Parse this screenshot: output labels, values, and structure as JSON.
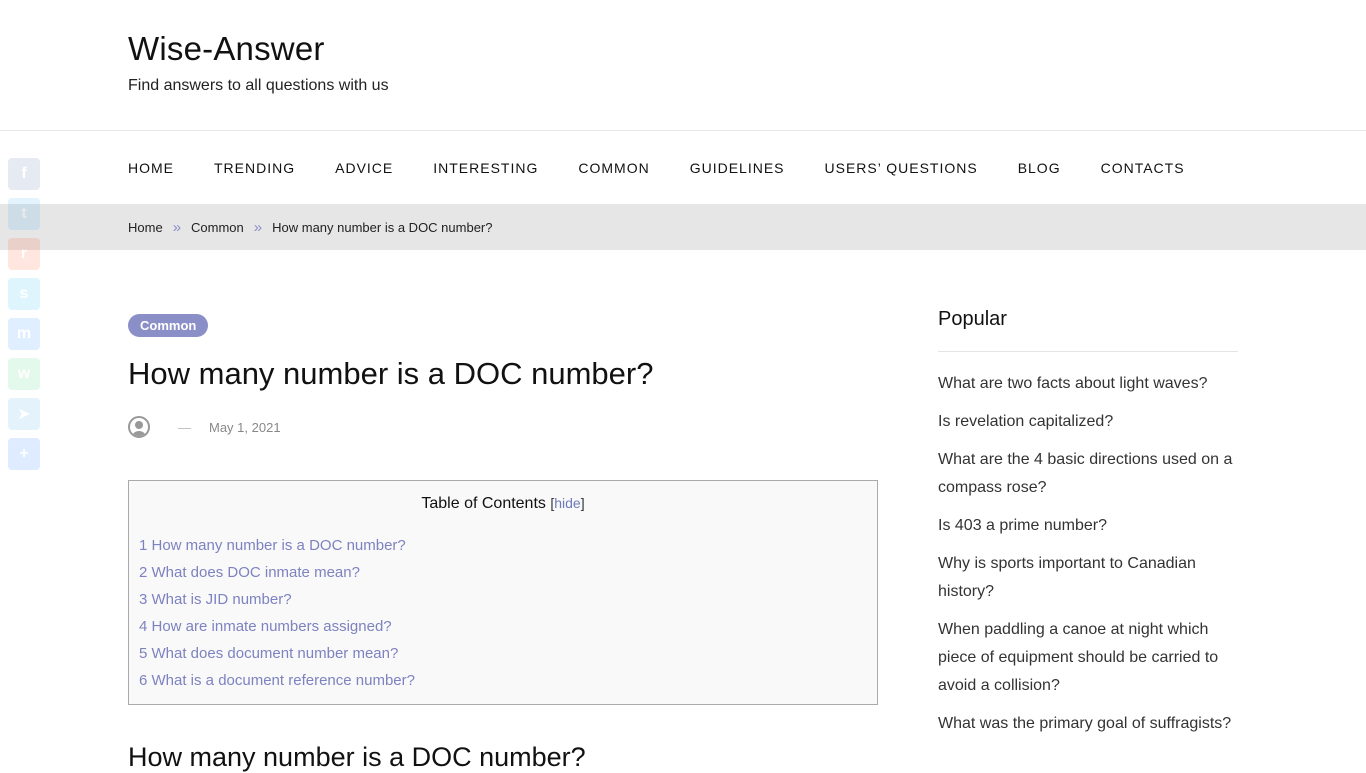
{
  "site": {
    "title": "Wise-Answer",
    "tagline": "Find answers to all questions with us"
  },
  "nav": {
    "items": [
      "HOME",
      "TRENDING",
      "ADVICE",
      "INTERESTING",
      "COMMON",
      "GUIDELINES",
      "USERS’ QUESTIONS",
      "BLOG",
      "CONTACTS"
    ]
  },
  "breadcrumb": {
    "home": "Home",
    "category": "Common",
    "current": "How many number is a DOC number?",
    "separator": "»"
  },
  "share_bar": {
    "icons": [
      "facebook-icon",
      "twitter-icon",
      "reddit-icon",
      "skype-icon",
      "messenger-icon",
      "whatsapp-icon",
      "telegram-icon",
      "share-plus-icon"
    ],
    "colors": [
      "#3b5998",
      "#1da1f2",
      "#ff4500",
      "#00aff0",
      "#0084ff",
      "#25d366",
      "#2ca5e0",
      "#0166ff"
    ]
  },
  "post": {
    "category": "Common",
    "title": "How many number is a DOC number?",
    "meta_dash": "—",
    "date": "May 1, 2021"
  },
  "toc": {
    "title": "Table of Contents",
    "bracket_open": "[",
    "hide_label": "hide",
    "bracket_close": "]",
    "items": [
      "1 How many number is a DOC number?",
      "2 What does DOC inmate mean?",
      "3 What is JID number?",
      "4 How are inmate numbers assigned?",
      "5 What does document number mean?",
      "6 What is a document reference number?"
    ]
  },
  "section": {
    "heading": "How many number is a DOC number?"
  },
  "sidebar": {
    "title": "Popular",
    "items": [
      "What are two facts about light waves?",
      "Is revelation capitalized?",
      "What are the 4 basic directions used on a compass rose?",
      "Is 403 a prime number?",
      "Why is sports important to Canadian history?",
      "When paddling a canoe at night which piece of equipment should be carried to avoid a collision?",
      "What was the primary goal of suffragists?"
    ]
  },
  "colors": {
    "accent": "#8b8fc8",
    "link": "#7d82c0",
    "breadcrumb_bg": "#e6e6e6"
  }
}
